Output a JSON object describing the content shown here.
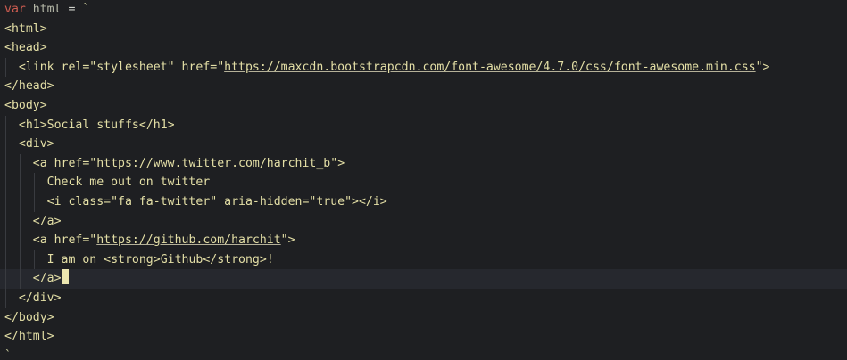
{
  "code": {
    "l1": {
      "keyword": "var",
      "name": " html ",
      "op": "=",
      "tick": " `"
    },
    "l2": "<html>",
    "l3": "<head>",
    "l4": {
      "pre": "<link rel=\"stylesheet\" href=\"",
      "url": "https://maxcdn.bootstrapcdn.com/font-awesome/4.7.0/css/font-awesome.min.css",
      "post": "\">"
    },
    "l5": "</head>",
    "l6": "<body>",
    "l7": {
      "open": "<h1>",
      "text": "Social stuffs",
      "close": "</h1>"
    },
    "l8": "<div>",
    "l9": {
      "pre": "<a href=\"",
      "url": "https://www.twitter.com/harchit_b",
      "post": "\">"
    },
    "l10": "Check me out on twitter",
    "l11": "<i class=\"fa fa-twitter\" aria-hidden=\"true\"></i>",
    "l12": "</a>",
    "l13": {
      "pre": "<a href=\"",
      "url": "https://github.com/harchit",
      "post": "\">"
    },
    "l14": {
      "text": "I am on ",
      "open": "<strong>",
      "bold": "Github",
      "close": "</strong>",
      "tail": "!"
    },
    "l15": "</a>",
    "l16": "</div>",
    "l17": "</body>",
    "l18": "</html>",
    "l19": "`"
  }
}
